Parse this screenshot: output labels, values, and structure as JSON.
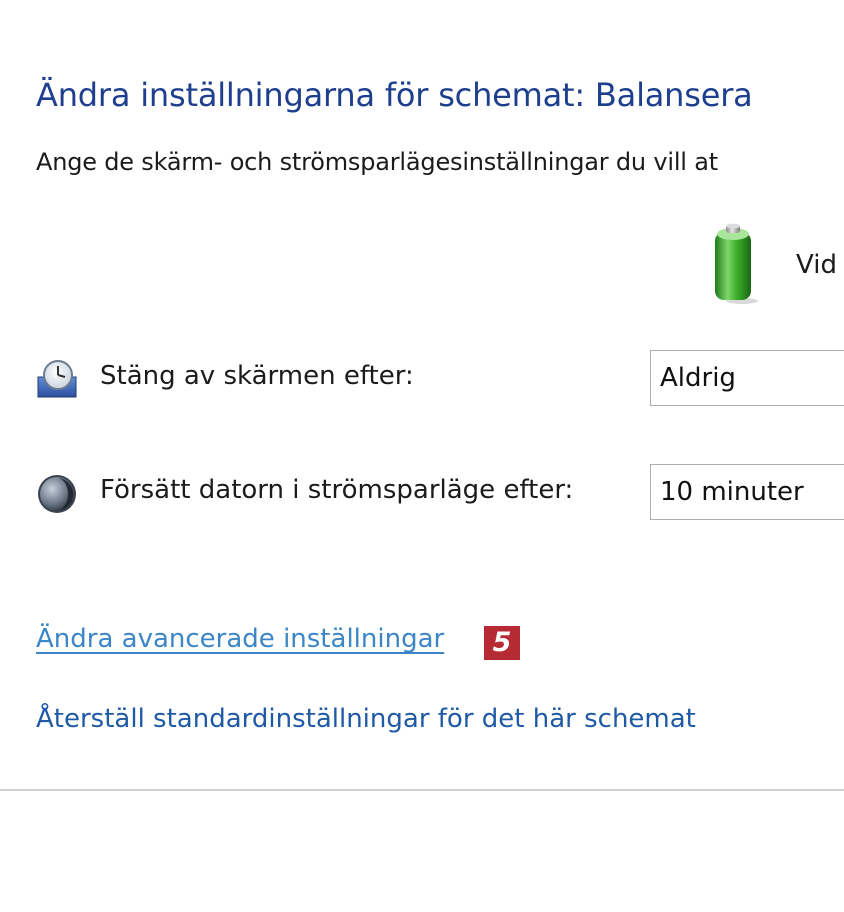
{
  "header": {
    "title": "Ändra inställningarna för schemat: Balansera",
    "description": "Ange de skärm- och strömsparlägesinställningar du vill at"
  },
  "columns": {
    "on_battery_icon": "battery-icon",
    "on_battery_label": "Vid"
  },
  "settings": [
    {
      "icon": "display-clock-icon",
      "label": "Stäng av skärmen efter:",
      "value": "Aldrig"
    },
    {
      "icon": "sleep-moon-icon",
      "label": "Försätt datorn i strömsparläge efter:",
      "value": "10 minuter"
    }
  ],
  "links": {
    "advanced": "Ändra avancerade inställningar",
    "restore": "Återställ standardinställningar för det här schemat"
  },
  "callout": {
    "number": "5",
    "color": "#b62a33"
  },
  "colors": {
    "title": "#1e3f8e",
    "link_advanced": "#3c86c8",
    "link_restore": "#1f5aa6"
  }
}
